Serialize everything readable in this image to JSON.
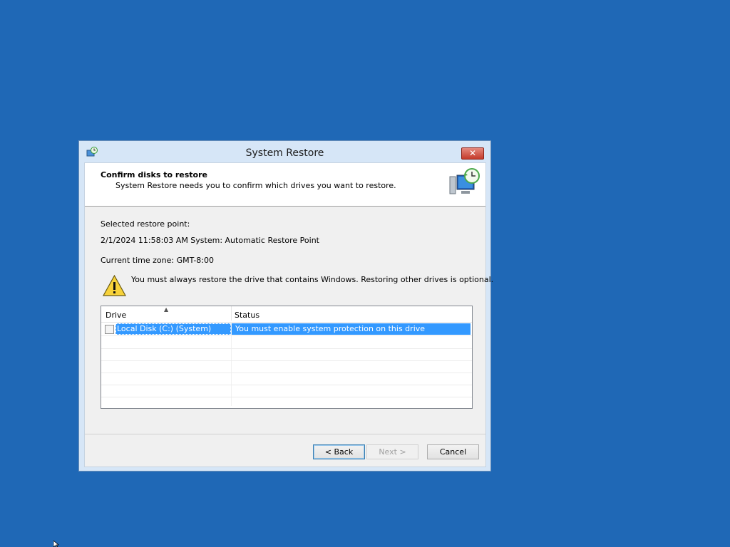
{
  "window": {
    "title": "System Restore",
    "close_label": "✕"
  },
  "header": {
    "title": "Confirm disks to restore",
    "subtitle": "System Restore needs you to confirm which drives you want to restore."
  },
  "body": {
    "selected_label": "Selected restore point:",
    "restore_point": "2/1/2024 11:58:03 AM System: Automatic Restore Point",
    "timezone": "Current time zone: GMT-8:00",
    "warning": "You must always restore the drive that contains Windows. Restoring other drives is optional."
  },
  "drives_table": {
    "columns": [
      "Drive",
      "Status"
    ],
    "rows": [
      {
        "drive": "Local Disk (C:) (System)",
        "status": "You must enable system protection on this drive",
        "checked": false
      }
    ]
  },
  "buttons": {
    "back": "< Back",
    "next": "Next >",
    "cancel": "Cancel"
  },
  "icons": {
    "app": "system-restore-icon",
    "header": "restore-computer-icon",
    "warning": "warning-icon"
  },
  "colors": {
    "desktop": "#1f68b6",
    "selection": "#3399ff",
    "close": "#c43b2b"
  }
}
